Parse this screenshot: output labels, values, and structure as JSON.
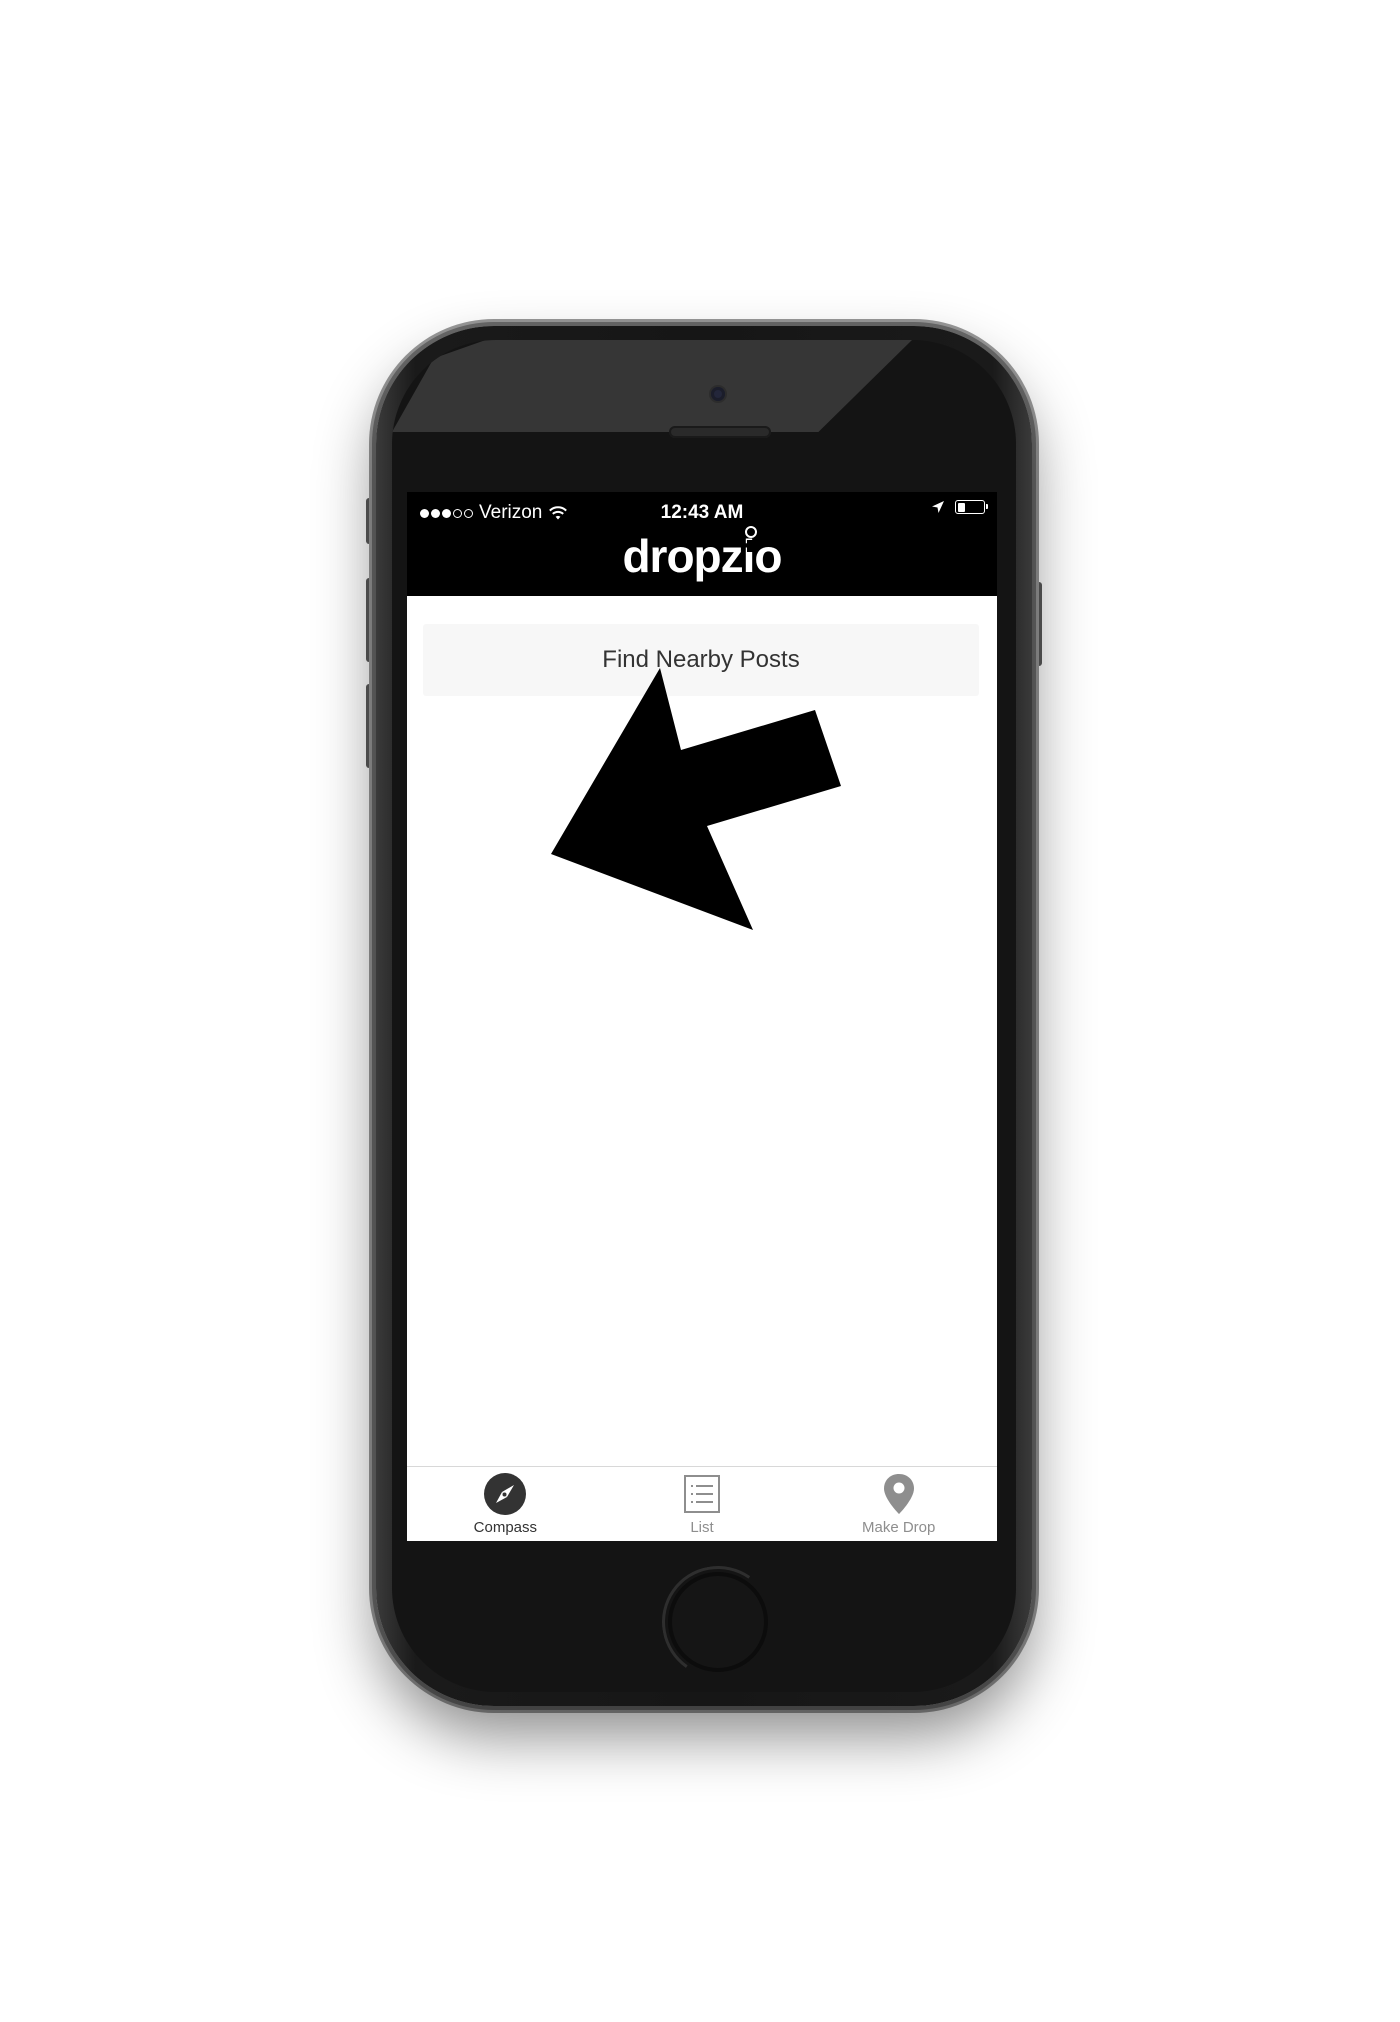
{
  "status_bar": {
    "carrier": "Verizon",
    "time": "12:43 AM",
    "signal_bars_filled": 3,
    "signal_bars_total": 5,
    "battery_level": 0.3,
    "icons": [
      "wifi-icon",
      "location-arrow-icon",
      "battery-icon"
    ]
  },
  "header": {
    "logo_text": "dropzio"
  },
  "main": {
    "find_button_label": "Find Nearby Posts",
    "compass_arrow": {
      "icon": "direction-arrow-icon",
      "color": "#000000"
    }
  },
  "tabbar": {
    "active_tab": "Compass",
    "tabs": [
      {
        "label": "Compass",
        "icon": "compass-icon"
      },
      {
        "label": "List",
        "icon": "list-icon"
      },
      {
        "label": "Make Drop",
        "icon": "map-pin-icon"
      }
    ]
  },
  "colors": {
    "header_background": "#000000",
    "button_background": "#f7f7f7",
    "active_tab": "#333333",
    "inactive_tab": "#8e8e8e"
  }
}
